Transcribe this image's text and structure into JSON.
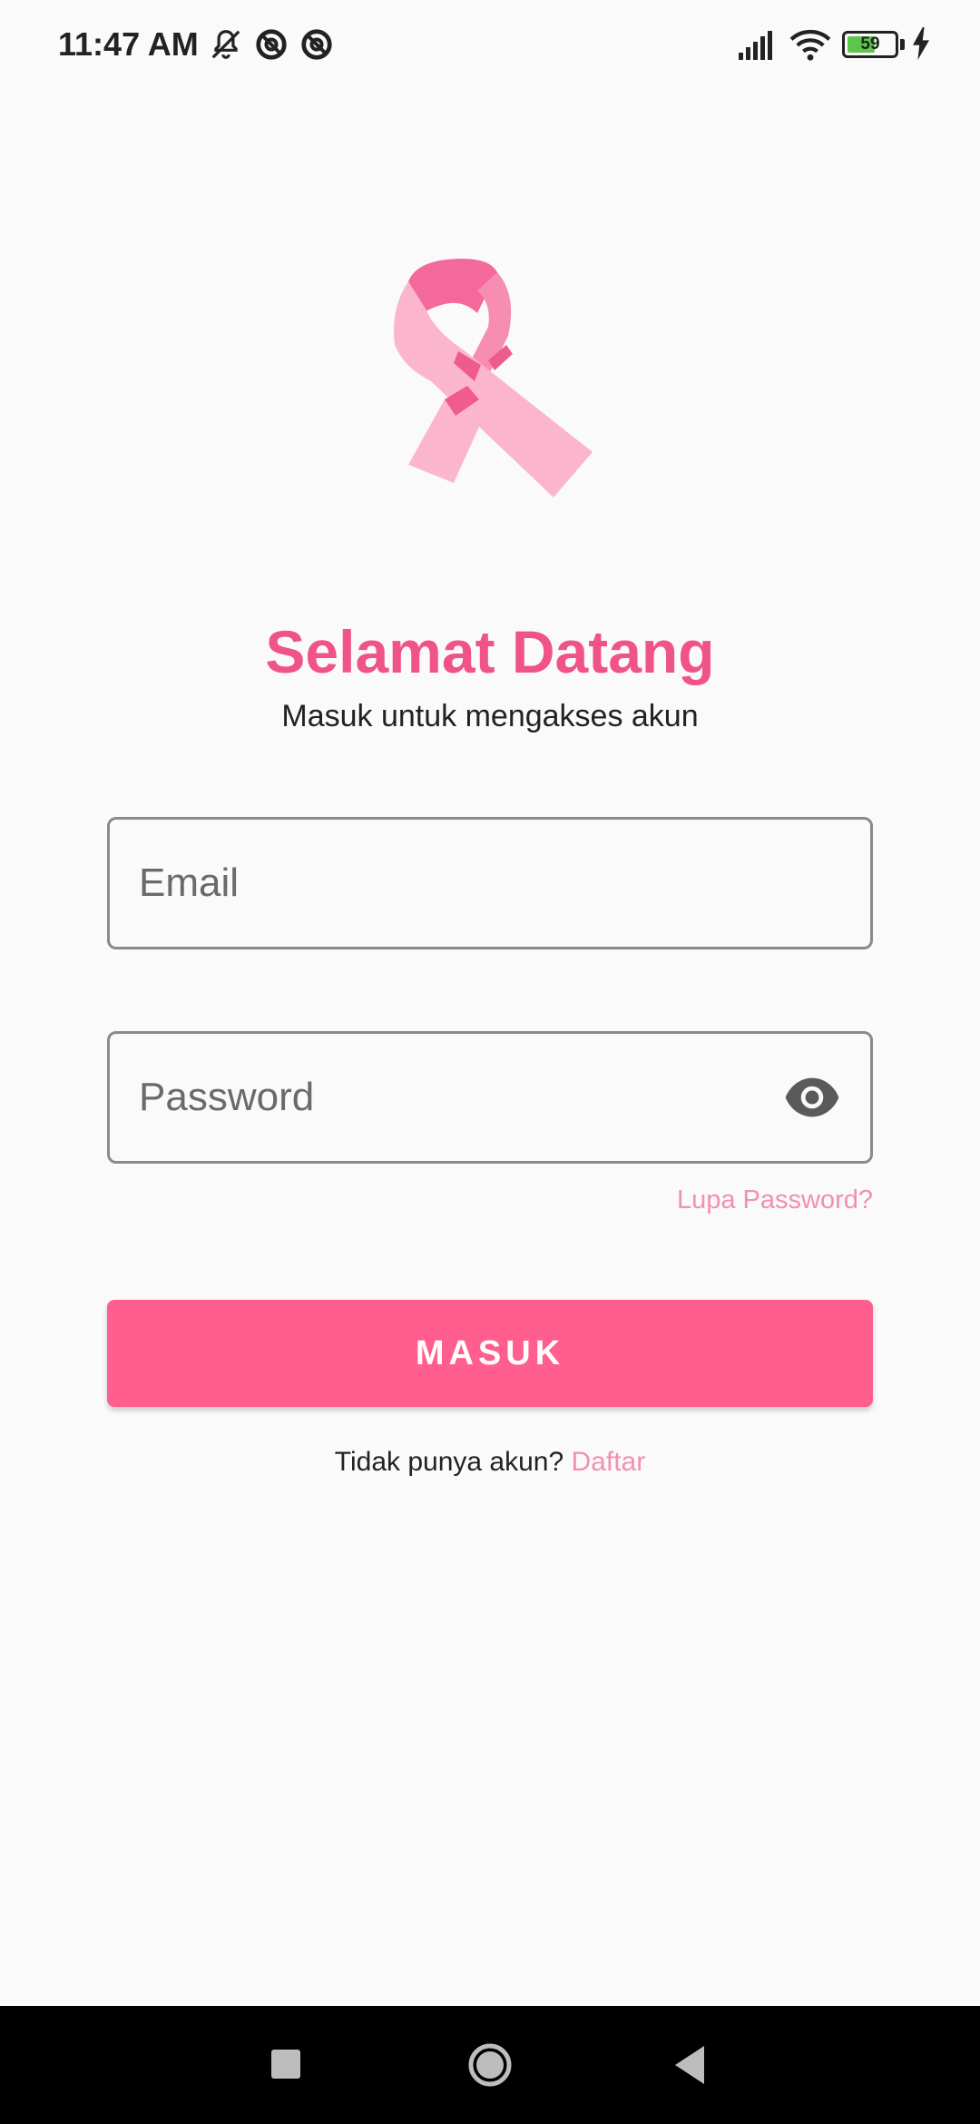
{
  "status_bar": {
    "time": "11:47 AM",
    "battery_level": "59",
    "battery_fraction": 0.59
  },
  "login": {
    "title": "Selamat Datang",
    "subtitle": "Masuk untuk mengakses akun",
    "email_placeholder": "Email",
    "password_placeholder": "Password",
    "forgot_password": "Lupa Password?",
    "submit_label": "MASUK",
    "signup_prompt": "Tidak punya akun?",
    "signup_link": "Daftar"
  },
  "icons": {
    "logo": "pink-ribbon-icon",
    "password_toggle": "eye-icon"
  },
  "colors": {
    "accent": "#ff5e8e",
    "title": "#f0528a",
    "link": "#f38fb1"
  }
}
